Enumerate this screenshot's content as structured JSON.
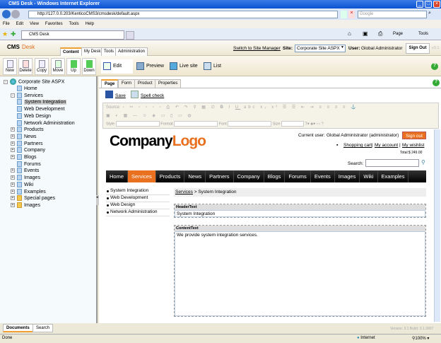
{
  "window": {
    "title": "CMS Desk - Windows Internet Explorer",
    "url": "http://127.0.0.203/KenticoCMS3/cmsdesk/default.aspx",
    "search_placeholder": "Google",
    "menu": [
      "File",
      "Edit",
      "View",
      "Favorites",
      "Tools",
      "Help"
    ],
    "tab": "CMS Desk",
    "cmd": {
      "page": "Page",
      "tools": "Tools"
    }
  },
  "header": {
    "brand1": "CMS",
    "brand2": "Desk",
    "tabs": [
      "Content",
      "My Desk",
      "Tools",
      "Administration"
    ],
    "switch": "Switch to Site Manager",
    "site_label": "Site:",
    "site_value": "Corporate Site ASPX",
    "user_label": "User:",
    "user_value": "Global Administrator",
    "signout": "Sign Out",
    "version": "v3.1"
  },
  "toolbar": {
    "buttons": [
      "New",
      "Delete",
      "Copy",
      "Move",
      "Up",
      "Down"
    ],
    "modes": [
      "Edit",
      "Preview",
      "Live site",
      "List"
    ]
  },
  "tree": {
    "root": "Corporate Site ASPX",
    "items": [
      {
        "label": "Home",
        "lvl": 1
      },
      {
        "label": "Services",
        "lvl": 1,
        "exp": "-"
      },
      {
        "label": "System Integration",
        "lvl": 2,
        "sel": true
      },
      {
        "label": "Web Development",
        "lvl": 2
      },
      {
        "label": "Web Design",
        "lvl": 2
      },
      {
        "label": "Network Administration",
        "lvl": 2
      },
      {
        "label": "Products",
        "lvl": 1,
        "exp": "+"
      },
      {
        "label": "News",
        "lvl": 1,
        "exp": "+"
      },
      {
        "label": "Partners",
        "lvl": 1,
        "exp": "+"
      },
      {
        "label": "Company",
        "lvl": 1,
        "exp": "+"
      },
      {
        "label": "Blogs",
        "lvl": 1,
        "exp": "+"
      },
      {
        "label": "Forums",
        "lvl": 1
      },
      {
        "label": "Events",
        "lvl": 1,
        "exp": "+"
      },
      {
        "label": "Images",
        "lvl": 1,
        "exp": "+"
      },
      {
        "label": "Wiki",
        "lvl": 1,
        "exp": "+"
      },
      {
        "label": "Examples",
        "lvl": 1,
        "exp": "+"
      },
      {
        "label": "Special pages",
        "lvl": 1,
        "exp": "+",
        "folder": true
      },
      {
        "label": "Images",
        "lvl": 1,
        "exp": "+",
        "folder": true
      }
    ]
  },
  "page_tabs": [
    "Page",
    "Form",
    "Product",
    "Properties"
  ],
  "actions": {
    "save": "Save",
    "spell": "Spell check"
  },
  "editor": {
    "source": "Source",
    "style": "Style",
    "format": "Format",
    "font": "Font",
    "size": "Size"
  },
  "site": {
    "logo1": "Company",
    "logo2": "Logo",
    "current_user_label": "Current user:",
    "current_user": "Global Administrator (administrator)",
    "signout": "Sign out",
    "cart": "Shopping cart",
    "account": "My account",
    "wishlist": "My wishlist",
    "total": "Total:$ 249.00",
    "search_label": "Search:",
    "menu": [
      "Home",
      "Services",
      "Products",
      "News",
      "Partners",
      "Company",
      "Blogs",
      "Forums",
      "Events",
      "Images",
      "Wiki",
      "Examples"
    ],
    "active": "Services",
    "leftnav": [
      "System Integration",
      "Web Development",
      "Web Design",
      "Network Administration"
    ],
    "crumb_link": "Services",
    "crumb_rest": " > System Integration",
    "header_label": "HeaderText",
    "header_value": "System Integration",
    "content_label": "ContentText",
    "content_value": "We provide system integration services."
  },
  "bottom": {
    "tabs": [
      "Documents",
      "Search"
    ],
    "version": "Version: 3.1 Build: 3.1.3007"
  },
  "status": {
    "text": "Done",
    "zone": "Internet",
    "zoom": "100%"
  }
}
